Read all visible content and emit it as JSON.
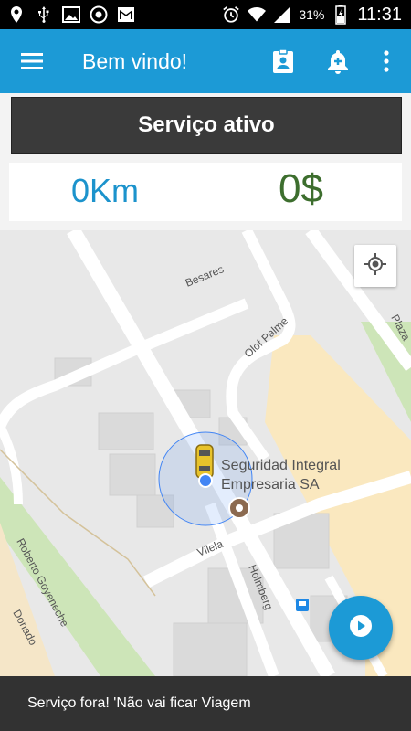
{
  "status_bar": {
    "battery_percent": "31%",
    "time": "11:31",
    "left_icons": [
      "location-icon",
      "usb-icon",
      "image-icon",
      "chrome-icon",
      "gmail-icon"
    ],
    "right_icons": [
      "alarm-icon",
      "wifi-icon",
      "signal-icon",
      "battery-icon"
    ]
  },
  "app_bar": {
    "title": "Bem vindo!",
    "color": "#1c9ad6",
    "actions": [
      "clipboard-icon",
      "add-alert-icon",
      "more-vert-icon"
    ]
  },
  "service": {
    "status_label": "Serviço ativo",
    "distance": "0Km",
    "price": "0$"
  },
  "map": {
    "streets": [
      "Besares",
      "Olof Palme",
      "Plaza",
      "Vilela",
      "Holmberg",
      "Roberto Goyeneche",
      "Donado"
    ],
    "place_name_line1": "Seguridad Integral",
    "place_name_line2": "Empresaria SA"
  },
  "snackbar": {
    "message": "Serviço fora! 'Não vai ficar Viagem"
  }
}
